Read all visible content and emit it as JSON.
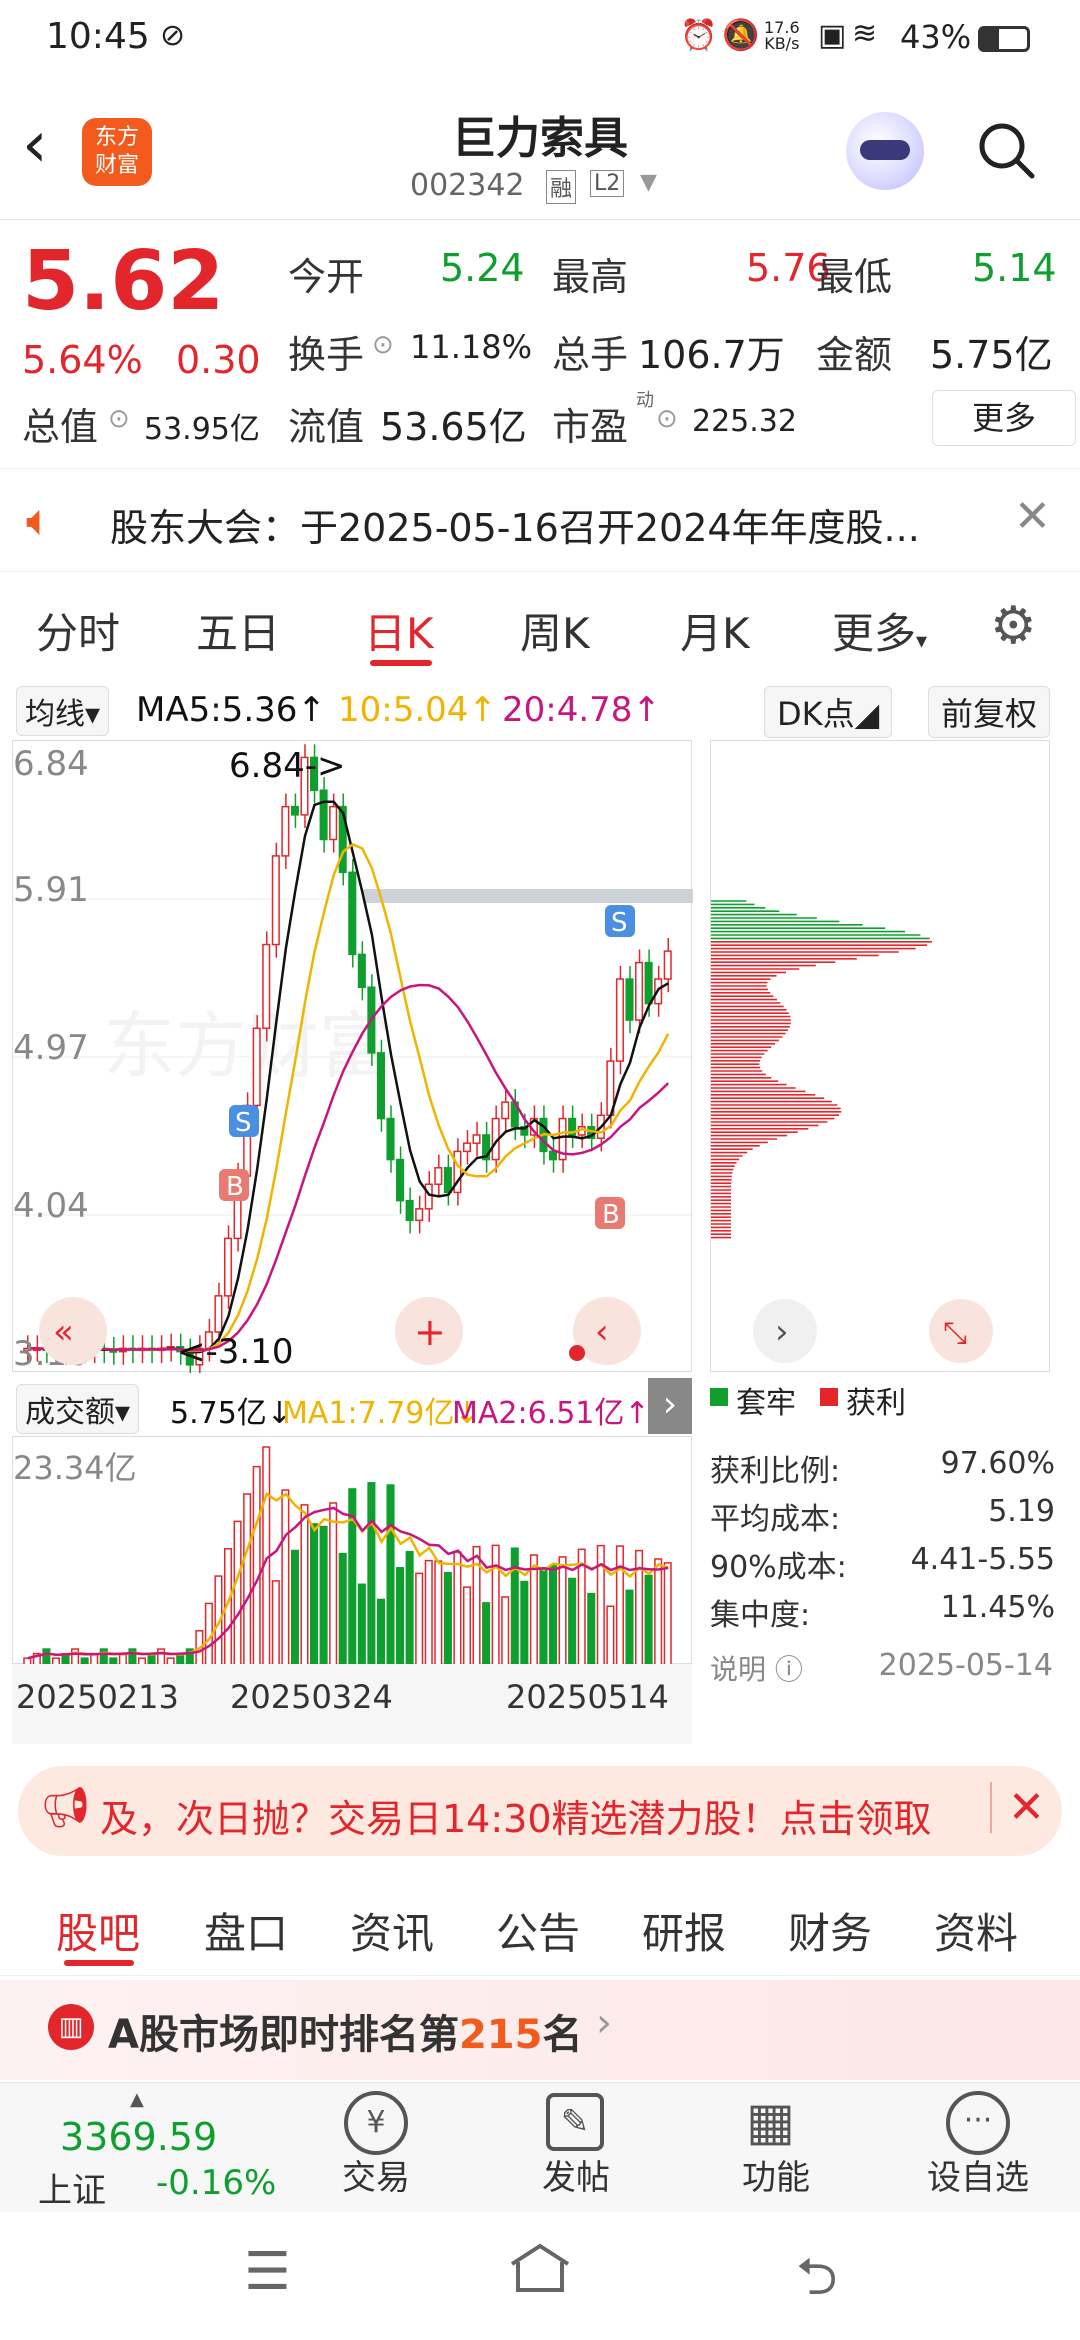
{
  "status": {
    "time": "10:45",
    "net_speed": "17.6",
    "net_unit": "KB/s",
    "battery": "43%"
  },
  "header": {
    "stock_name": "巨力索具",
    "stock_code": "002342",
    "tag_margin": "融",
    "tag_level": "L2"
  },
  "quote": {
    "price": "5.62",
    "change_pct": "5.64%",
    "change": "0.30",
    "open_label": "今开",
    "open": "5.24",
    "high_label": "最高",
    "high": "5.76",
    "low_label": "最低",
    "low": "5.14",
    "turnover_label": "换手",
    "turnover": "11.18%",
    "volume_label": "总手",
    "volume": "106.7万",
    "amount_label": "金额",
    "amount": "5.75亿",
    "mcap_label": "总值",
    "mcap": "53.95亿",
    "float_label": "流值",
    "float": "53.65亿",
    "pe_label": "市盈",
    "pe_sup": "动",
    "pe": "225.32",
    "more": "更多"
  },
  "notice": {
    "text": "股东大会：于2025-05-16召开2024年年度股..."
  },
  "chart_tabs": [
    "分时",
    "五日",
    "日K",
    "周K",
    "月K",
    "更多"
  ],
  "chart_toolbar": {
    "ma_select": "均线",
    "ma5": "MA5:5.36",
    "ma10": "10:5.04",
    "ma20": "20:4.78",
    "dk": "DK点",
    "adjust": "前复权"
  },
  "kline": {
    "y_labels": [
      "6.84",
      "5.91",
      "4.97",
      "4.04",
      "3.10"
    ],
    "high_marker": "6.84->",
    "low_marker": "<-3.10",
    "buy_mark": "B",
    "sell_mark": "S"
  },
  "volume": {
    "select": "成交额",
    "value": "5.75亿",
    "ma1": "MA1:7.79亿",
    "ma2": "MA2:6.51亿",
    "max_label": "23.34亿",
    "dates": [
      "20250213",
      "20250324",
      "20250514"
    ]
  },
  "chip_stats": {
    "legend_trapped": "套牢",
    "legend_profit": "获利",
    "rows": [
      {
        "k": "获利比例:",
        "v": "97.60%"
      },
      {
        "k": "平均成本:",
        "v": "5.19"
      },
      {
        "k": "90%成本:",
        "v": "4.41-5.55"
      },
      {
        "k": "集中度:",
        "v": "11.45%"
      }
    ],
    "note": "说明",
    "date": "2025-05-14"
  },
  "banner": {
    "text": "及，次日抛？交易日14:30精选潜力股！点击领取"
  },
  "stock_tabs": [
    "股吧",
    "盘口",
    "资讯",
    "公告",
    "研报",
    "财务",
    "资料"
  ],
  "ranking": {
    "prefix": "A股市场即时排名第",
    "rank": "215",
    "suffix": "名"
  },
  "bottom": {
    "index_value": "3369.59",
    "index_name": "上证",
    "index_change": "-0.16%",
    "items": [
      "交易",
      "发帖",
      "功能",
      "设自选"
    ]
  },
  "colors": {
    "up": "#e2262c",
    "down": "#0e9f2e",
    "ma5": "#111111",
    "ma10": "#f0b400",
    "ma20": "#c8157f"
  }
}
